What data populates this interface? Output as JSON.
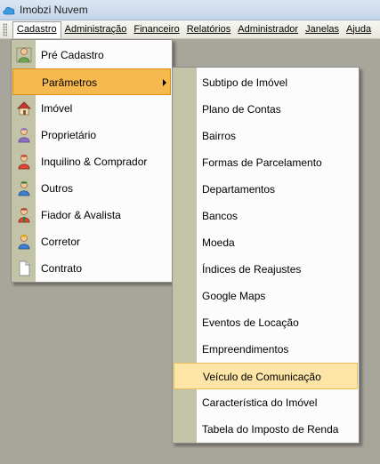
{
  "window": {
    "title": "Imobzi Nuvem"
  },
  "menubar": {
    "items": [
      {
        "label": "Cadastro"
      },
      {
        "label": "Administração"
      },
      {
        "label": "Financeiro"
      },
      {
        "label": "Relatórios"
      },
      {
        "label": "Administrador"
      },
      {
        "label": "Janelas"
      },
      {
        "label": "Ajuda"
      }
    ]
  },
  "cadastro_menu": {
    "items": [
      {
        "label": "Pré Cadastro",
        "icon": "pre-cadastro-person-icon"
      },
      {
        "label": "Parâmetros",
        "icon": "",
        "submenu": true,
        "highlighted": true
      },
      {
        "label": "Imóvel",
        "icon": "house-icon"
      },
      {
        "label": "Proprietário",
        "icon": "proprietario-person-icon"
      },
      {
        "label": "Inquilino & Comprador",
        "icon": "inquilino-person-icon"
      },
      {
        "label": "Outros",
        "icon": "outros-person-icon"
      },
      {
        "label": "Fiador & Avalista",
        "icon": "fiador-person-icon"
      },
      {
        "label": "Corretor",
        "icon": "corretor-person-icon"
      },
      {
        "label": "Contrato",
        "icon": "document-icon"
      }
    ]
  },
  "parametros_menu": {
    "items": [
      {
        "label": "Subtipo de Imóvel"
      },
      {
        "label": "Plano de Contas"
      },
      {
        "label": "Bairros"
      },
      {
        "label": "Formas de Parcelamento"
      },
      {
        "label": "Departamentos"
      },
      {
        "label": "Bancos"
      },
      {
        "label": "Moeda"
      },
      {
        "label": "Índices de Reajustes"
      },
      {
        "label": "Google Maps"
      },
      {
        "label": "Eventos de Locação"
      },
      {
        "label": "Empreendimentos"
      },
      {
        "label": "Veículo de Comunicação",
        "highlighted": true
      },
      {
        "label": "Característica do Imóvel"
      },
      {
        "label": "Tabela do Imposto de Renda"
      }
    ]
  },
  "colors": {
    "gutter": "#c3c3a8",
    "highlight_dark": "#f5b94f",
    "highlight_light": "#fce5a6",
    "background": "#a8a59a"
  }
}
